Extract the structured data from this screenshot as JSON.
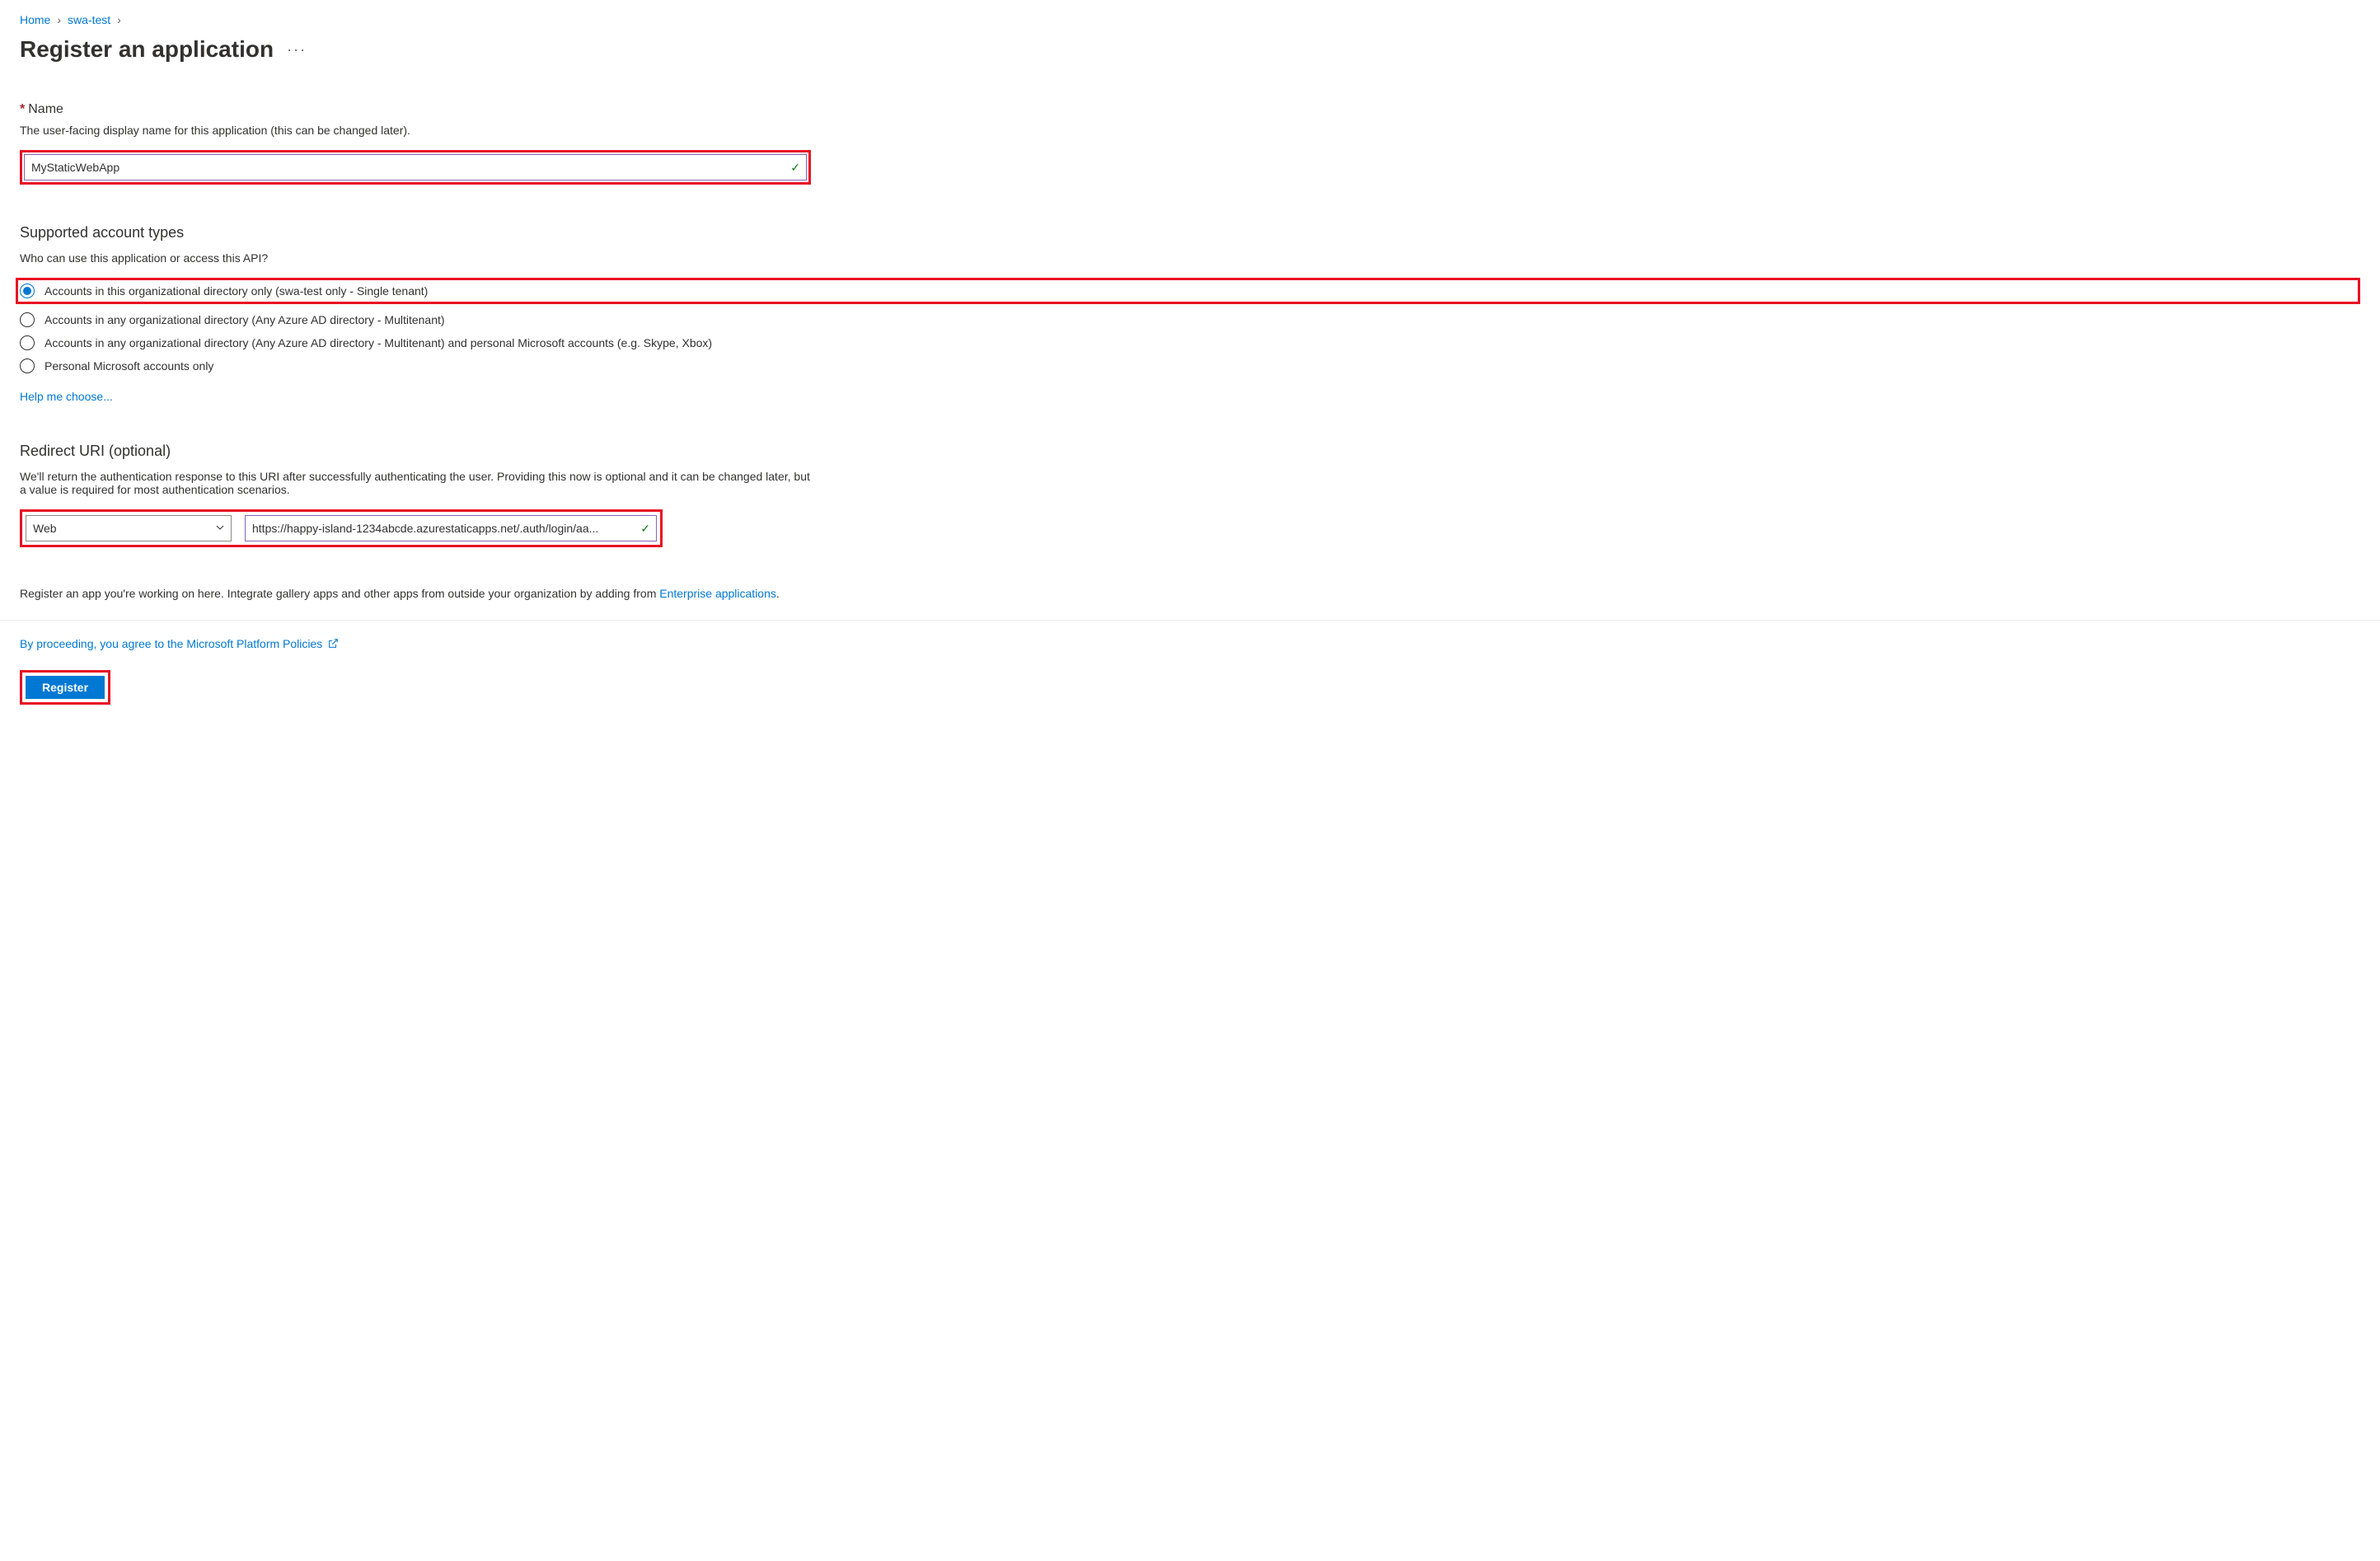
{
  "breadcrumb": {
    "home": "Home",
    "swa_test": "swa-test"
  },
  "page_title": "Register an application",
  "name_section": {
    "label": "Name",
    "description": "The user-facing display name for this application (this can be changed later).",
    "value": "MyStaticWebApp"
  },
  "account_types": {
    "title": "Supported account types",
    "description": "Who can use this application or access this API?",
    "options": [
      "Accounts in this organizational directory only (swa-test only - Single tenant)",
      "Accounts in any organizational directory (Any Azure AD directory - Multitenant)",
      "Accounts in any organizational directory (Any Azure AD directory - Multitenant) and personal Microsoft accounts (e.g. Skype, Xbox)",
      "Personal Microsoft accounts only"
    ],
    "help_link": "Help me choose..."
  },
  "redirect_uri": {
    "title": "Redirect URI (optional)",
    "description": "We'll return the authentication response to this URI after successfully authenticating the user. Providing this now is optional and it can be changed later, but a value is required for most authentication scenarios.",
    "platform": "Web",
    "uri": "https://happy-island-1234abcde.azurestaticapps.net/.auth/login/aa..."
  },
  "footer": {
    "register_text_before": "Register an app you're working on here. Integrate gallery apps and other apps from outside your organization by adding from ",
    "enterprise_link": "Enterprise applications",
    "period": ".",
    "policies_text": "By proceeding, you agree to the Microsoft Platform Policies",
    "register_button": "Register"
  }
}
